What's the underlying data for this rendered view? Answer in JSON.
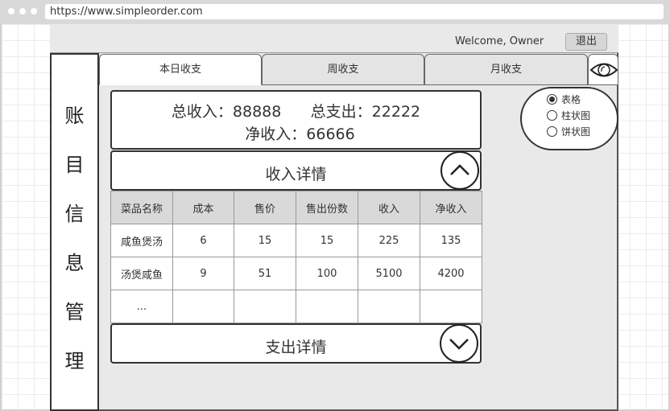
{
  "browser": {
    "url": "https://www.simpleorder.com"
  },
  "header": {
    "welcome_text": "Welcome, Owner",
    "logout_label": "退出"
  },
  "sidebar": {
    "chars": [
      "账",
      "目",
      "信",
      "息",
      "管",
      "理"
    ]
  },
  "tabs": [
    {
      "label": "本日收支",
      "active": true
    },
    {
      "label": "周收支",
      "active": false
    },
    {
      "label": "月收支",
      "active": false
    }
  ],
  "summary": {
    "total_income_label": "总收入：",
    "total_income": "88888",
    "total_expense_label": "总支出：",
    "total_expense": "22222",
    "net_income_label": "净收入：",
    "net_income": "66666"
  },
  "income_section": {
    "title": "收入详情",
    "expanded": true,
    "columns": [
      "菜品名称",
      "成本",
      "售价",
      "售出份数",
      "收入",
      "净收入"
    ],
    "rows": [
      [
        "咸鱼煲汤",
        "6",
        "15",
        "15",
        "225",
        "135"
      ],
      [
        "汤煲咸鱼",
        "9",
        "51",
        "100",
        "5100",
        "4200"
      ],
      [
        "...",
        "",
        "",
        "",
        "",
        ""
      ]
    ]
  },
  "expense_section": {
    "title": "支出详情",
    "expanded": false
  },
  "view_options": {
    "selected": "表格",
    "options": [
      "表格",
      "柱状图",
      "饼状图"
    ]
  },
  "colors": {
    "app_bg": "#e9e9e9",
    "border": "#333333",
    "header_cell": "#d9d9d9"
  }
}
